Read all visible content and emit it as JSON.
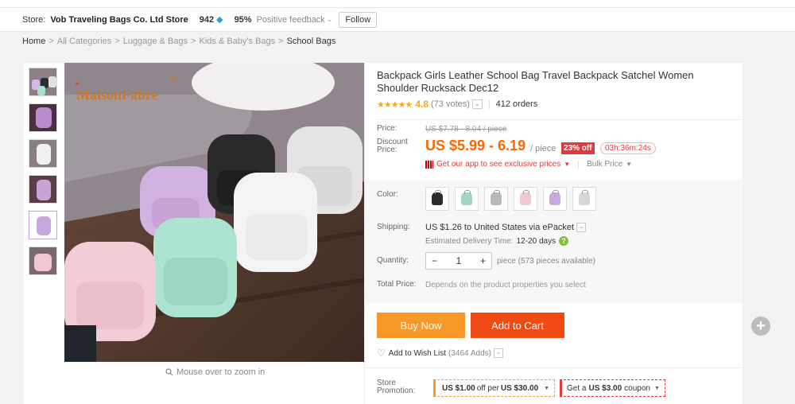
{
  "store": {
    "label": "Store:",
    "name": "Vob Traveling Bags Co. Ltd Store",
    "score": "942",
    "feedback_pct": "95%",
    "feedback_label": "Positive feedback",
    "follow_label": "Follow"
  },
  "breadcrumb": [
    "Home",
    "All Categories",
    "Luggage & Bags",
    "Kids & Baby's Bags",
    "School Bags"
  ],
  "gallery": {
    "brand_watermark": "MaisonFabre",
    "zoom_hint": "Mouse over to zoom in"
  },
  "product": {
    "title": "Backpack Girls Leather School Bag Travel Backpack Satchel Women Shoulder Rucksack Dec12",
    "rating": "4.8",
    "votes": "(73 votes)",
    "orders": "412 orders",
    "price_label": "Price:",
    "old_price": "US $7.78 - 8.04 / piece",
    "discount_label": "Discount Price:",
    "price": "US $5.99 - 6.19",
    "per_piece": "/ piece",
    "discount_badge": "23% off",
    "timer": "03h:36m:24s",
    "app_promo": "Get our app to see exclusive prices",
    "bulk_price": "Bulk Price",
    "color_label": "Color:",
    "colors": [
      "#2b2b2b",
      "#9fd6c6",
      "#b8b8b8",
      "#f0c6d0",
      "#c9a9df",
      "#d6d6d6"
    ],
    "shipping_label": "Shipping:",
    "shipping": "US $1.26 to United States via ePacket",
    "delivery_label": "Estimated Delivery Time:",
    "delivery_days": "12-20 days",
    "quantity_label": "Quantity:",
    "quantity": "1",
    "qty_minus": "−",
    "qty_plus": "+",
    "pieces_note": "piece (573 pieces available)",
    "total_label": "Total Price:",
    "total_note": "Depends on the product properties you select",
    "buy_now": "Buy Now",
    "add_to_cart": "Add to Cart",
    "wishlist": "Add to Wish List",
    "wish_count": "(3464 Adds)",
    "promotion_label": "Store Promotion:",
    "promo1_prefix": "US $1.00",
    "promo1_mid": "off per",
    "promo1_suffix": "US $30.00",
    "promo2_prefix": "Get a",
    "promo2_amount": "US $3.00",
    "promo2_suffix": "coupon"
  }
}
